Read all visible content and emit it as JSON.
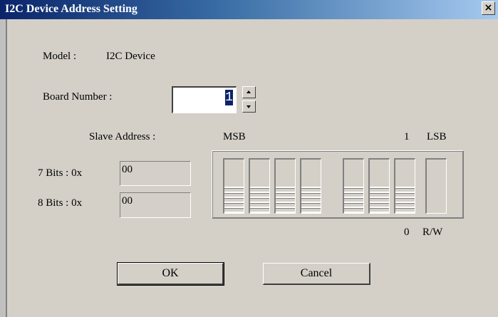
{
  "window": {
    "title": "I2C Device Address Setting",
    "close_glyph": "×"
  },
  "model": {
    "label": "Model :",
    "value": "I2C Device"
  },
  "board": {
    "label": "Board Number :",
    "value": "1"
  },
  "slave": {
    "label": "Slave Address :",
    "msb": "MSB",
    "lsb": "LSB",
    "top_bit": "1",
    "bottom_bit": "0",
    "rw": "R/W",
    "seven_bits": {
      "label": "7 Bits : 0x",
      "value": "00"
    },
    "eight_bits": {
      "label": "8 Bits : 0x",
      "value": "00"
    },
    "switches": [
      0,
      0,
      0,
      0,
      0,
      0,
      0,
      0
    ]
  },
  "buttons": {
    "ok": "OK",
    "cancel": "Cancel"
  }
}
